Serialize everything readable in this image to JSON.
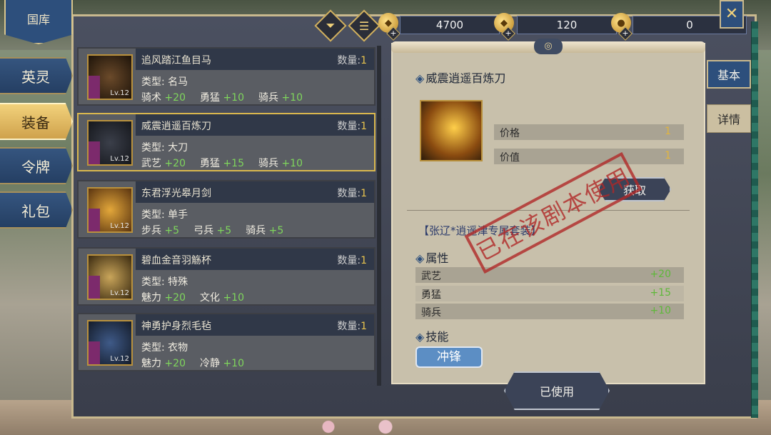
{
  "header": {
    "tab_title": "国库"
  },
  "sidebar": {
    "items": [
      {
        "label": "英灵"
      },
      {
        "label": "装备",
        "active": true
      },
      {
        "label": "令牌"
      },
      {
        "label": "礼包"
      }
    ]
  },
  "resources": [
    {
      "icon": "gold-ingot-icon",
      "value": "4700"
    },
    {
      "icon": "treasure-pot-icon",
      "value": "120"
    },
    {
      "icon": "coin-icon",
      "value": "0"
    }
  ],
  "toolbar": {
    "filter_icon": "filter-icon",
    "list_icon": "list-icon",
    "close_icon": "close-tools-icon"
  },
  "equipment_list": [
    {
      "name": "追风踏江鱼目马",
      "qty_label": "数量:",
      "qty": "1",
      "type": "类型: 名马",
      "stats": [
        [
          "骑术",
          "+20"
        ],
        [
          "勇猛",
          "+10"
        ],
        [
          "骑兵",
          "+10"
        ]
      ],
      "level": "Lv.12"
    },
    {
      "name": "威震逍遥百炼刀",
      "qty_label": "数量:",
      "qty": "1",
      "type": "类型: 大刀",
      "stats": [
        [
          "武艺",
          "+20"
        ],
        [
          "勇猛",
          "+15"
        ],
        [
          "骑兵",
          "+10"
        ]
      ],
      "level": "Lv.12",
      "selected": true
    },
    {
      "name": "东君浮光皋月剑",
      "qty_label": "数量:",
      "qty": "1",
      "type": "类型: 单手",
      "stats": [
        [
          "步兵",
          "+5"
        ],
        [
          "弓兵",
          "+5"
        ],
        [
          "骑兵",
          "+5"
        ]
      ],
      "level": "Lv.12"
    },
    {
      "name": "碧血金音羽觞杯",
      "qty_label": "数量:",
      "qty": "1",
      "type": "类型: 特殊",
      "stats": [
        [
          "魅力",
          "+20"
        ],
        [
          "文化",
          "+10"
        ]
      ],
      "level": "Lv.12"
    },
    {
      "name": "神勇护身烈毛毡",
      "qty_label": "数量:",
      "qty": "1",
      "type": "类型: 衣物",
      "stats": [
        [
          "魅力",
          "+20"
        ],
        [
          "冷静",
          "+10"
        ]
      ],
      "level": "Lv.12"
    }
  ],
  "detail": {
    "title": "威震逍遥百炼刀",
    "price_label": "价格",
    "price_value": "1",
    "worth_label": "价值",
    "worth_value": "1",
    "get_button": "获取",
    "set_name": "【张辽*逍遥津专属套装】",
    "attr_title": "属性",
    "attrs": [
      {
        "label": "武艺",
        "value": "+20"
      },
      {
        "label": "勇猛",
        "value": "+15"
      },
      {
        "label": "骑兵",
        "value": "+10"
      }
    ],
    "skill_title": "技能",
    "skill": "冲锋",
    "stamp": "已在该剧本使用",
    "used_button": "已使用"
  },
  "right_tabs": [
    {
      "label": "基本"
    },
    {
      "label": "详情"
    }
  ],
  "colors": {
    "accent_blue": "#2d4f7c",
    "gold": "#e2b53d",
    "green": "#5fb83a",
    "stamp_red": "#b02828"
  }
}
